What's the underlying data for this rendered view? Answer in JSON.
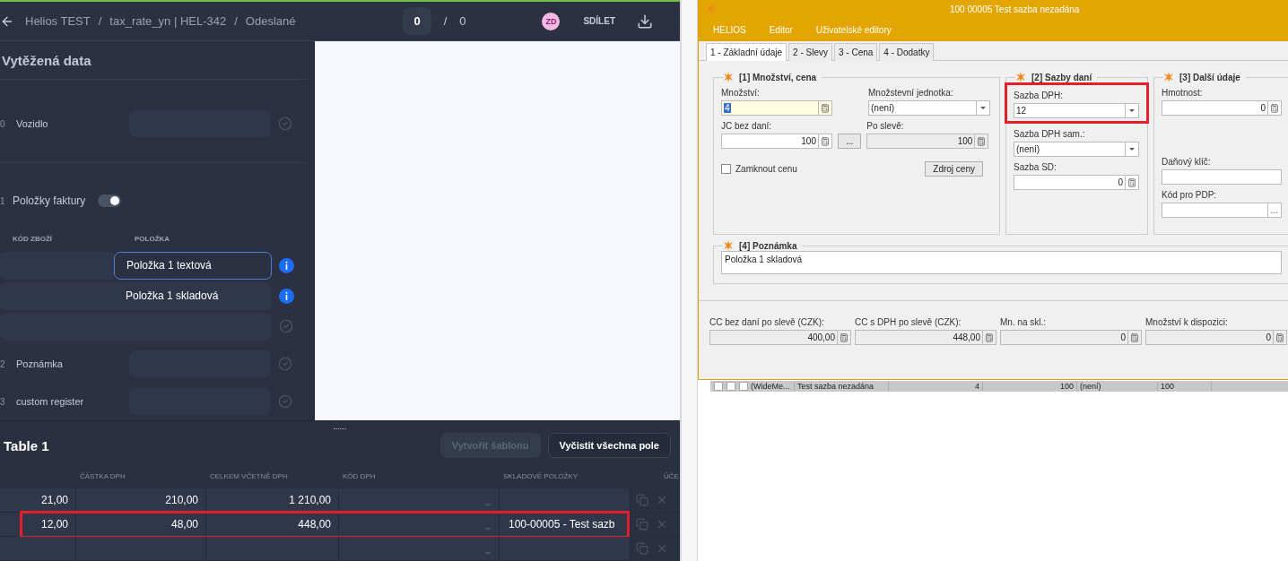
{
  "header": {
    "breadcrumb": [
      "Helios TEST",
      "tax_rate_yn | HEL-342",
      "Odeslané"
    ],
    "separator": "/",
    "counter": {
      "current": "0",
      "separator": "/",
      "total": "0"
    },
    "avatar": "ZD",
    "share": "SDÍLET"
  },
  "extracted": {
    "title": "Vytěžená data",
    "fields_before": [
      {
        "number": "0",
        "label": "Vozidlo"
      }
    ],
    "section": {
      "number": "1",
      "title": "Položky faktury",
      "on": true
    },
    "columns": [
      "KÓD ZBOŽÍ",
      "POLOŽKA"
    ],
    "items": [
      {
        "value": "Položka 1 textová",
        "selected": true,
        "kind": "info"
      },
      {
        "value": "Položka 1 skladová",
        "selected": false,
        "kind": "info"
      },
      {
        "selected": false,
        "kind": "check"
      }
    ],
    "fields_after": [
      {
        "number": "2",
        "label": "Poznámka"
      },
      {
        "number": "3",
        "label": "custom register"
      }
    ]
  },
  "table": {
    "title": "Table 1",
    "buttons": [
      {
        "label": "Vytvořit šablonu",
        "disabled": true
      },
      {
        "label": "Vyčistit všechna pole",
        "disabled": false
      }
    ],
    "columns": [
      "ČÁSTKA DPH",
      "CELKEM VČETNĚ DPH",
      "KÓD DPH",
      "SKLADOVÉ POLOŽKY",
      "ÚČE"
    ],
    "rows": [
      {
        "rate": "21,00",
        "vat": "210,00",
        "total": "1 210,00",
        "highlighted": false
      },
      {
        "rate": "12,00",
        "vat": "48,00",
        "total": "448,00",
        "stock_item": "100-00005 - Test sazb",
        "highlighted": true
      },
      {
        "highlighted": false
      }
    ]
  },
  "helios": {
    "title": "100 00005 Test sazba nezadána",
    "menu": [
      "HELIOS",
      "Editor",
      "Uživatelské editory"
    ],
    "tabs": [
      {
        "label": "1 - Základní údaje",
        "selected": true
      },
      {
        "label": "2 - Slevy",
        "selected": false
      },
      {
        "label": "3 - Cena",
        "selected": false
      },
      {
        "label": "4 - Dodatky",
        "selected": false
      }
    ],
    "group1": {
      "title": "[1] Množství, cena",
      "quantity": {
        "label": "Množství:",
        "value": "4"
      },
      "unit": {
        "label": "Množstevní jednotka:",
        "value": "(není)"
      },
      "price": {
        "label": "JC bez daní:",
        "value": "100"
      },
      "more": "...",
      "discounted": {
        "label": "Po slevě:",
        "value": "100"
      },
      "lock": {
        "label": "Zamknout cenu",
        "checked": false
      },
      "source": "Zdroj ceny"
    },
    "group2": {
      "title": "[2] Sazby daní",
      "vat": {
        "label": "Sazba DPH:",
        "value": "12",
        "highlighted": true
      },
      "vat_self": {
        "label": "Sazba DPH sam.:",
        "value": "(není)"
      },
      "sd": {
        "label": "Sazba SD:",
        "value": "0"
      }
    },
    "group3": {
      "title": "[3] Další údaje",
      "weight": {
        "label": "Hmotnost:",
        "value": "0"
      },
      "tax_key": {
        "label": "Daňový klíč:"
      },
      "pdp": {
        "label": "Kód pro PDP:",
        "more": "..."
      }
    },
    "note": {
      "title": "[4] Poznámka",
      "value": "Položka 1 skladová"
    },
    "totals": [
      {
        "label": "CC bez daní po slevě (CZK):",
        "value": "400,00"
      },
      {
        "label": "CC s DPH po slevě (CZK):",
        "value": "448,00"
      },
      {
        "label": "Mn. na skl.:",
        "value": "0"
      },
      {
        "label": "Množství k dispozici:",
        "value": "0"
      }
    ],
    "grid_checks": [
      false,
      false,
      false
    ],
    "grid_row": [
      "(WideMe...",
      "Test sazba nezadána",
      "4",
      "100",
      "(není)",
      "100"
    ]
  }
}
